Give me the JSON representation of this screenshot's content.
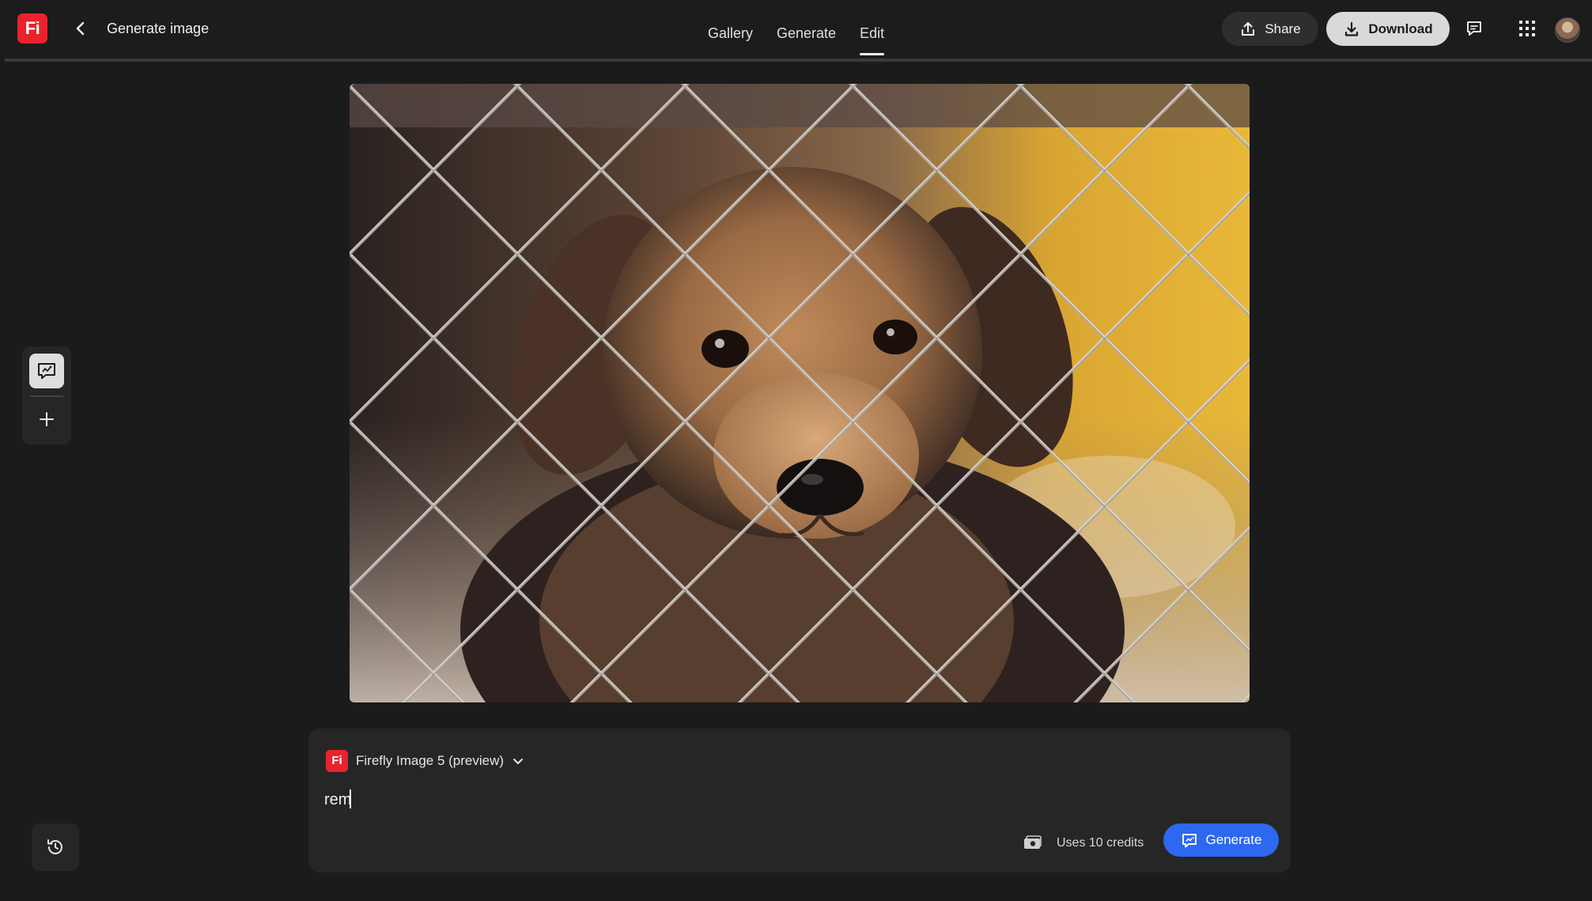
{
  "app": {
    "logo_text": "Fi",
    "page_title": "Generate image"
  },
  "nav": {
    "tabs": [
      {
        "label": "Gallery",
        "active": false
      },
      {
        "label": "Generate",
        "active": false
      },
      {
        "label": "Edit",
        "active": true
      }
    ]
  },
  "toolbar": {
    "share_label": "Share",
    "download_label": "Download",
    "icons": [
      "share-icon",
      "download-icon",
      "comment-icon",
      "apps-grid-icon"
    ]
  },
  "canvas": {
    "image_subject": "puppy-behind-chain-link-fence"
  },
  "tool_rail": {
    "icons": [
      "edit-image-icon",
      "add-icon"
    ]
  },
  "prompt": {
    "model_logo_text": "Fi",
    "model_name": "Firefly Image 5 (preview)",
    "input_value": "rem",
    "credits_label": "Uses 10 credits",
    "generate_label": "Generate"
  },
  "colors": {
    "background": "#1b1b1b",
    "panel": "#262626",
    "brand_red": "#e8232d",
    "generate_blue": "#2d68f0",
    "download_bg": "#d9d9d9"
  }
}
